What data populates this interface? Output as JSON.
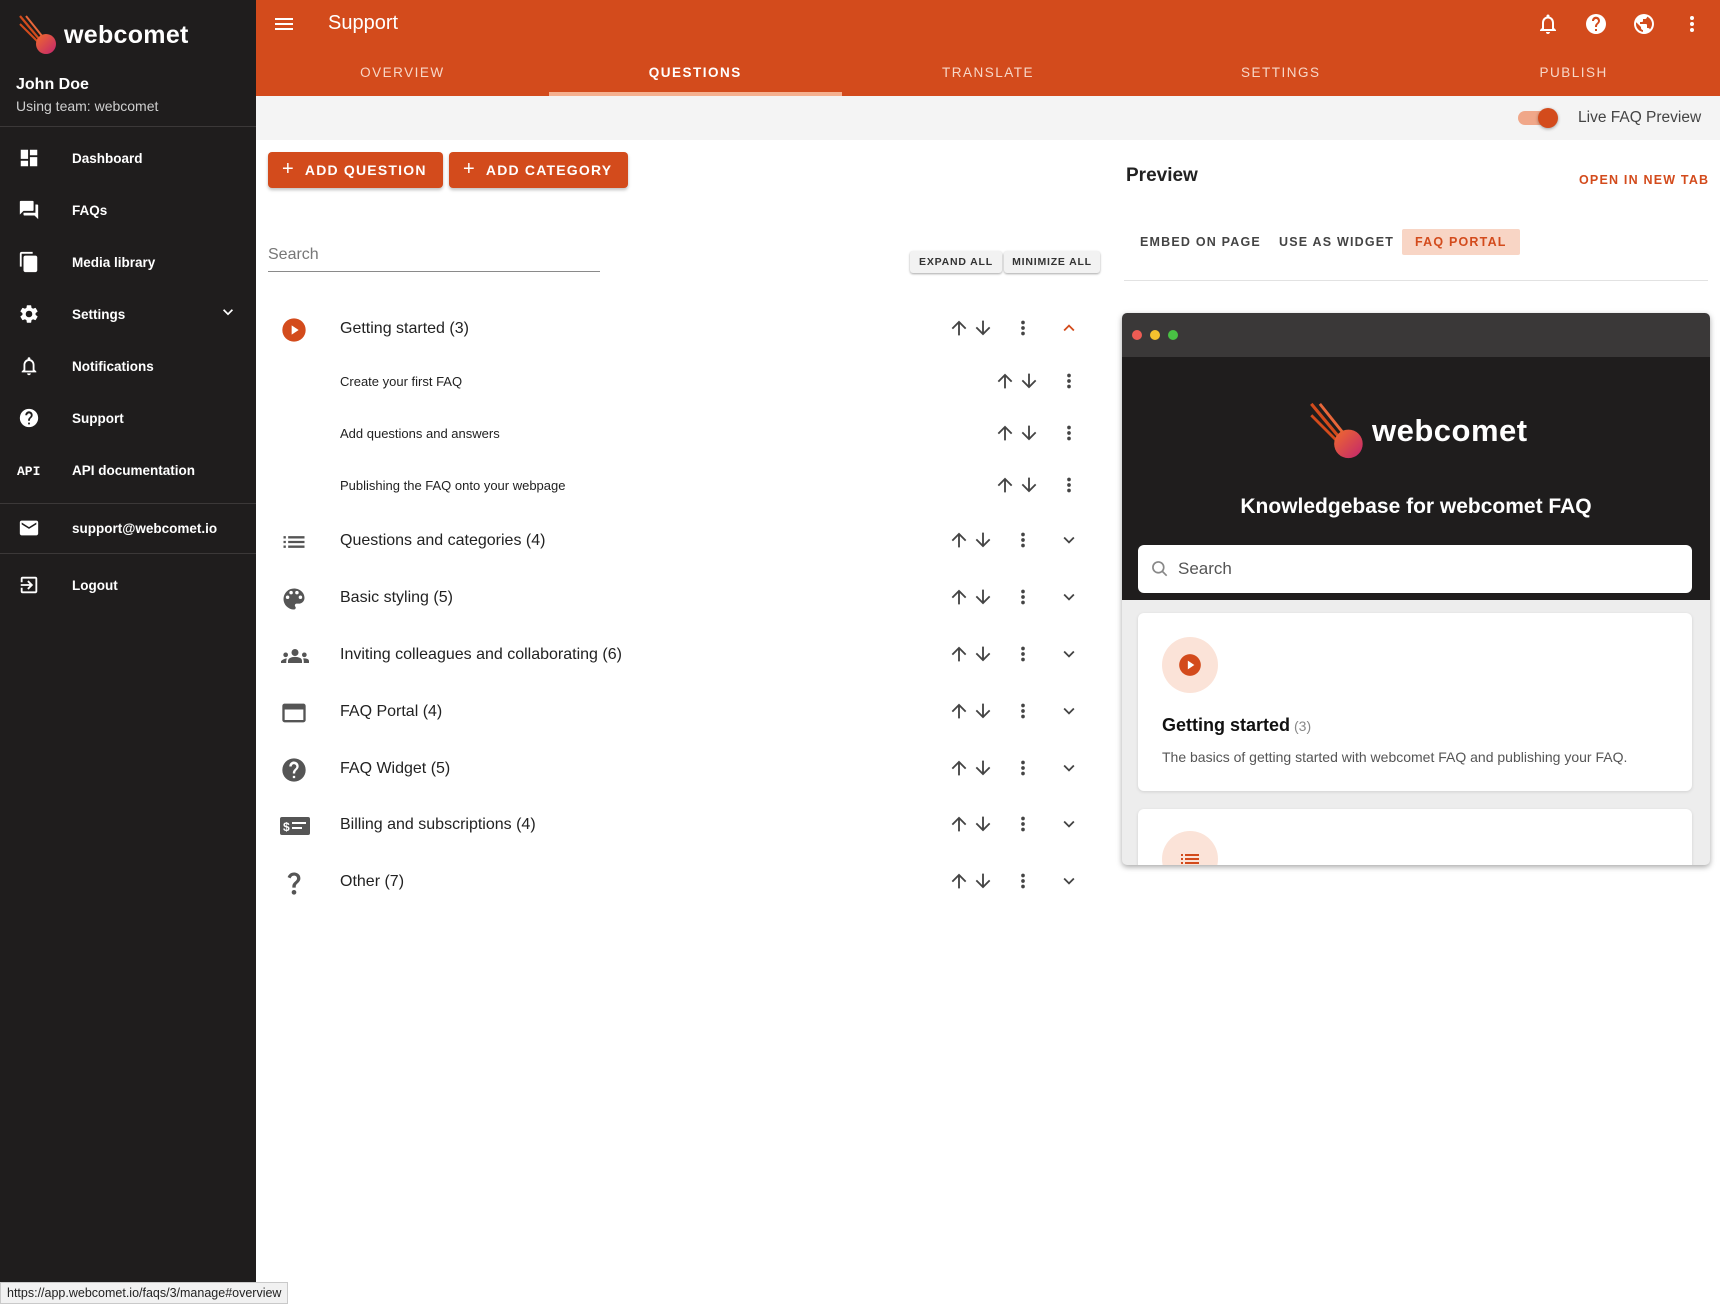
{
  "brand": {
    "name": "webcomet"
  },
  "user": {
    "name": "John Doe",
    "team": "Using team: webcomet"
  },
  "sidebar": {
    "items": [
      {
        "label": "Dashboard",
        "icon": "dashboard-icon"
      },
      {
        "label": "FAQs",
        "icon": "faq-icon"
      },
      {
        "label": "Media library",
        "icon": "media-library-icon"
      },
      {
        "label": "Settings",
        "icon": "gear-icon"
      },
      {
        "label": "Notifications",
        "icon": "bell-icon"
      },
      {
        "label": "Support",
        "icon": "help-circle-icon"
      },
      {
        "label": "API documentation",
        "icon": "api-icon"
      }
    ],
    "email": "support@webcomet.io",
    "logout": "Logout"
  },
  "status_url": "https://app.webcomet.io/faqs/3/manage#overview",
  "header": {
    "title": "Support"
  },
  "tabs": [
    {
      "label": "OVERVIEW"
    },
    {
      "label": "QUESTIONS"
    },
    {
      "label": "TRANSLATE"
    },
    {
      "label": "SETTINGS"
    },
    {
      "label": "PUBLISH"
    }
  ],
  "toolbar": {
    "live_preview_label": "Live FAQ Preview",
    "live_preview_on": true
  },
  "actions": {
    "add_question": "ADD QUESTION",
    "add_category": "ADD CATEGORY"
  },
  "search": {
    "placeholder": "Search"
  },
  "list_controls": {
    "expand_all": "EXPAND ALL",
    "minimize_all": "MINIMIZE ALL"
  },
  "categories": [
    {
      "title": "Getting started (3)",
      "icon": "play-circle-icon",
      "expanded": true,
      "questions": [
        "Create your first FAQ",
        "Add questions and answers",
        "Publishing the FAQ onto your webpage"
      ]
    },
    {
      "title": "Questions and categories (4)",
      "icon": "list-icon"
    },
    {
      "title": "Basic styling (5)",
      "icon": "palette-icon"
    },
    {
      "title": "Inviting colleagues and collaborating (6)",
      "icon": "people-icon"
    },
    {
      "title": "FAQ Portal (4)",
      "icon": "window-icon"
    },
    {
      "title": "FAQ Widget (5)",
      "icon": "help-circle-icon"
    },
    {
      "title": "Billing and subscriptions (4)",
      "icon": "billing-icon"
    },
    {
      "title": "Other (7)",
      "icon": "question-mark-icon"
    }
  ],
  "preview": {
    "title": "Preview",
    "open_new_tab": "OPEN IN NEW TAB",
    "tabs": [
      {
        "label": "EMBED ON PAGE"
      },
      {
        "label": "USE AS WIDGET"
      },
      {
        "label": "FAQ PORTAL",
        "active": true
      }
    ],
    "portal": {
      "brand": "webcomet",
      "heading": "Knowledgebase for webcomet FAQ",
      "search_placeholder": "Search",
      "card": {
        "title": "Getting started",
        "count": "(3)",
        "description": "The basics of getting started with webcomet FAQ and publishing your FAQ."
      }
    }
  },
  "colors": {
    "accent": "#d34b1c",
    "sidebar_bg": "#1f1d1d",
    "accent_light": "#f5b08f"
  }
}
